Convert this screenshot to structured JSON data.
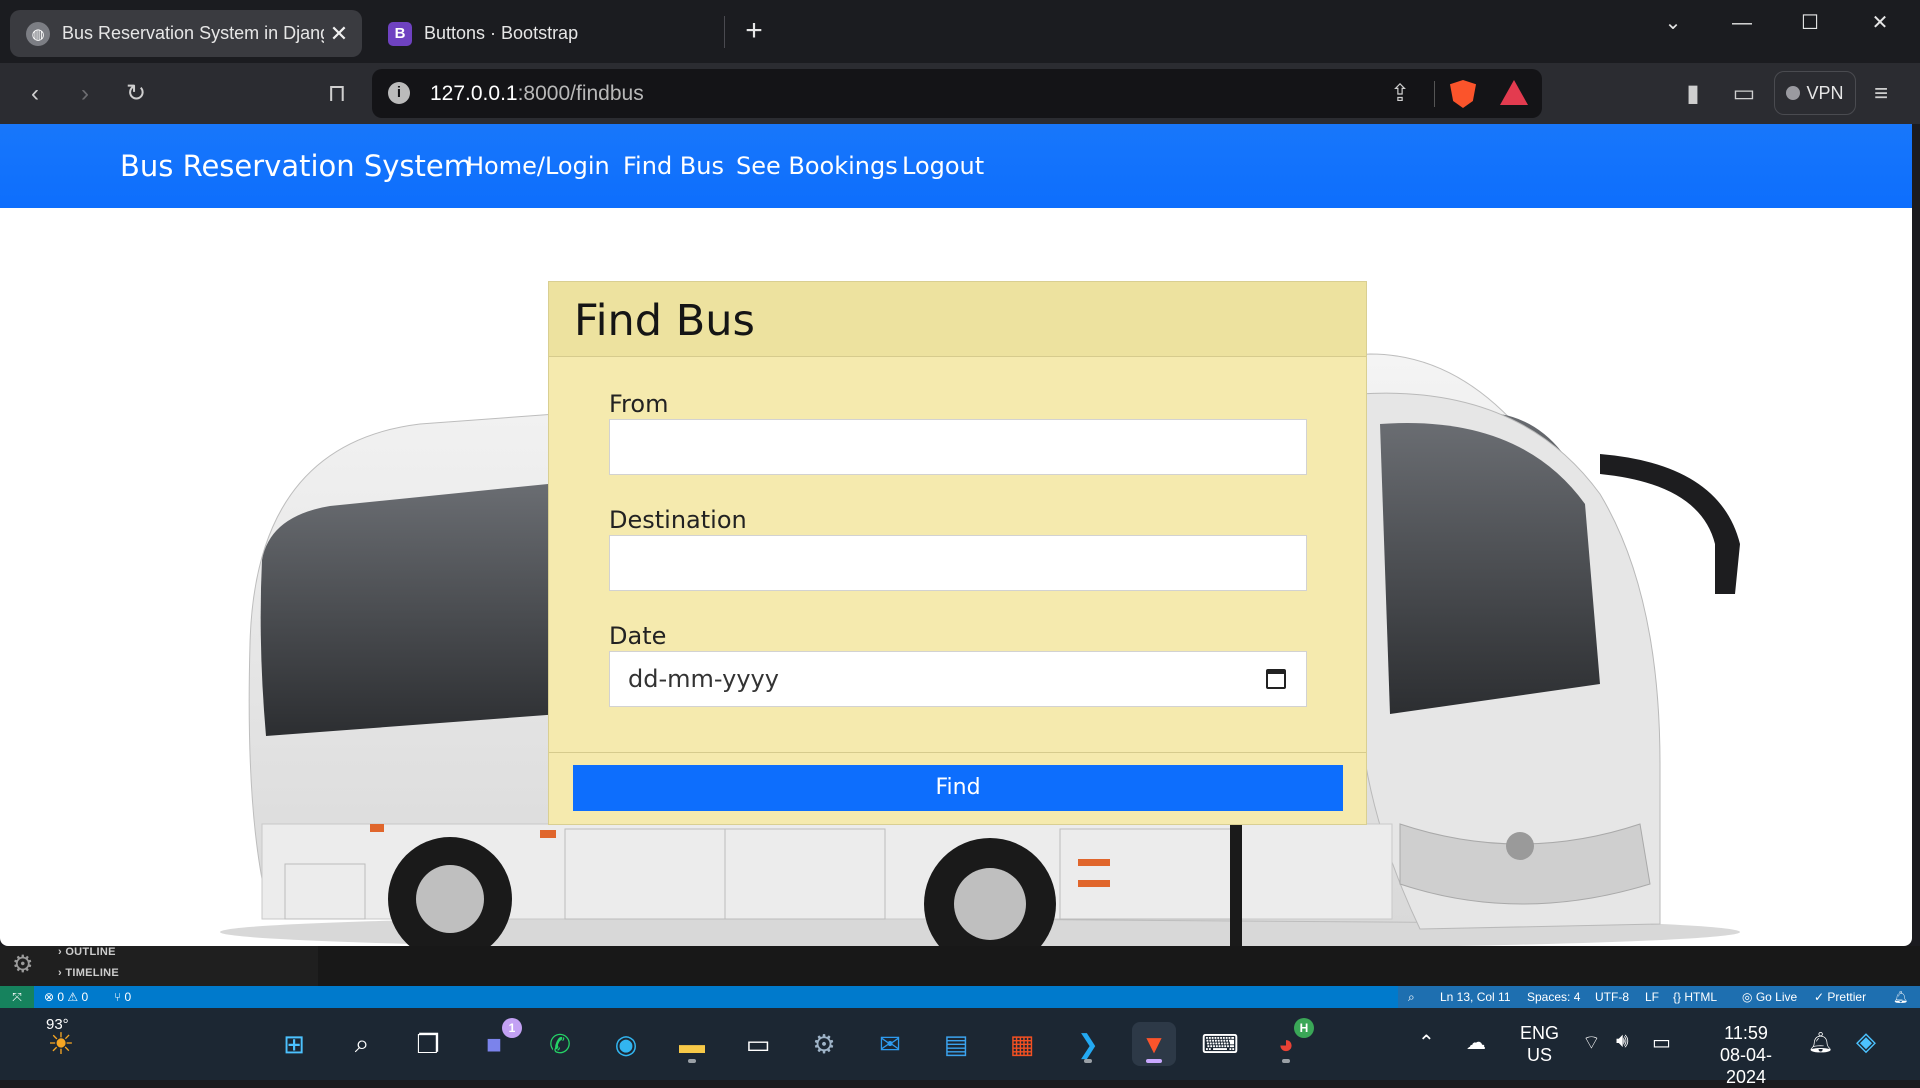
{
  "browser": {
    "tabs": [
      {
        "label": "Bus Reservation System in Djang",
        "favicon": "globe-icon",
        "active": true
      },
      {
        "label": "Buttons · Bootstrap",
        "favicon": "B",
        "active": false
      }
    ],
    "url_host": "127.0.0.1",
    "url_path": ":8000/findbus",
    "vpn_label": "VPN"
  },
  "navbar": {
    "brand": "Bus Reservation System",
    "links": [
      "Home/Login",
      "Find Bus",
      "See Bookings",
      "Logout"
    ],
    "color": "#0d6efd"
  },
  "form": {
    "title": "Find Bus",
    "from_label": "From",
    "from_value": "",
    "destination_label": "Destination",
    "destination_value": "",
    "date_label": "Date",
    "date_placeholder": "dd-mm-yyyy",
    "submit_label": "Find",
    "card_color": "#f5eaae"
  },
  "vscode": {
    "outline_label": "OUTLINE",
    "timeline_label": "TIMELINE",
    "status": {
      "problems": "⊗ 0 ⚠ 0",
      "ports": "⑂ 0",
      "cursor": "Ln 13, Col 11",
      "spaces": "Spaces: 4",
      "encoding": "UTF-8",
      "eol": "LF",
      "language": "{} HTML",
      "golive": "Go Live",
      "prettier": "✓ Prettier"
    }
  },
  "taskbar": {
    "weather_temp": "93°",
    "teams_badge": "1",
    "chrome_badge": "H",
    "lang_line1": "ENG",
    "lang_line2": "US",
    "time": "11:59",
    "date": "08-04-2024"
  }
}
